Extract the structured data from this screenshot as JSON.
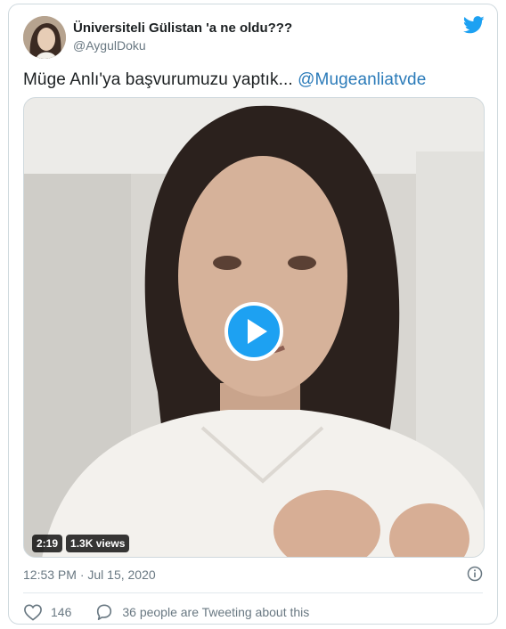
{
  "author": {
    "display_name": "Üniversiteli Gülistan 'a ne oldu???",
    "handle": "@AygulDoku"
  },
  "tweet": {
    "text": "Müge Anlı'ya başvurumuzu yaptık...",
    "mention": "@Mugeanliatvde"
  },
  "video": {
    "duration": "2:19",
    "views": "1.3K views"
  },
  "timestamp": "12:53 PM · Jul 15, 2020",
  "engagement": {
    "likes": "146",
    "replies_label": "36 people are Tweeting about this"
  },
  "colors": {
    "brand": "#1da1f2",
    "mention": "#2b7bb9",
    "secondary_text": "#697882"
  },
  "icons": [
    "twitter-bird-icon",
    "play-icon",
    "info-icon",
    "heart-icon",
    "comment-icon"
  ]
}
